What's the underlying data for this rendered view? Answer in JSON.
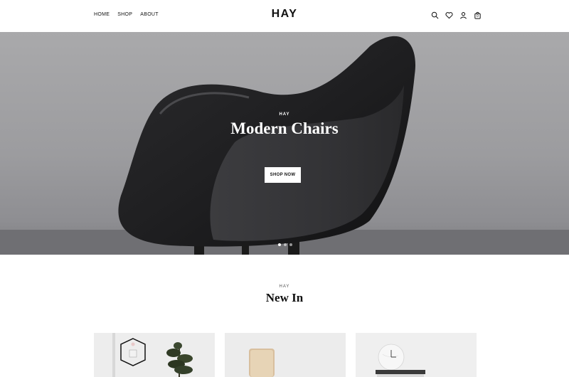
{
  "header": {
    "nav": [
      {
        "label": "HOME"
      },
      {
        "label": "SHOP"
      },
      {
        "label": "ABOUT"
      }
    ],
    "logo": "HAY",
    "icons": [
      "search-icon",
      "heart-icon",
      "user-icon",
      "cart-icon"
    ],
    "cart_count": "0"
  },
  "hero": {
    "overline": "HAY",
    "title": "Modern Chairs",
    "button_label": "SHOP NOW",
    "slides": [
      {
        "active": true
      },
      {
        "active": false
      },
      {
        "active": false
      }
    ]
  },
  "new_in": {
    "overline": "HAY",
    "title": "New In",
    "products": [
      {
        "image": "candle-holder-and-plant"
      },
      {
        "image": "wooden-mirror"
      },
      {
        "image": "marble-clock-on-shelf"
      }
    ]
  }
}
